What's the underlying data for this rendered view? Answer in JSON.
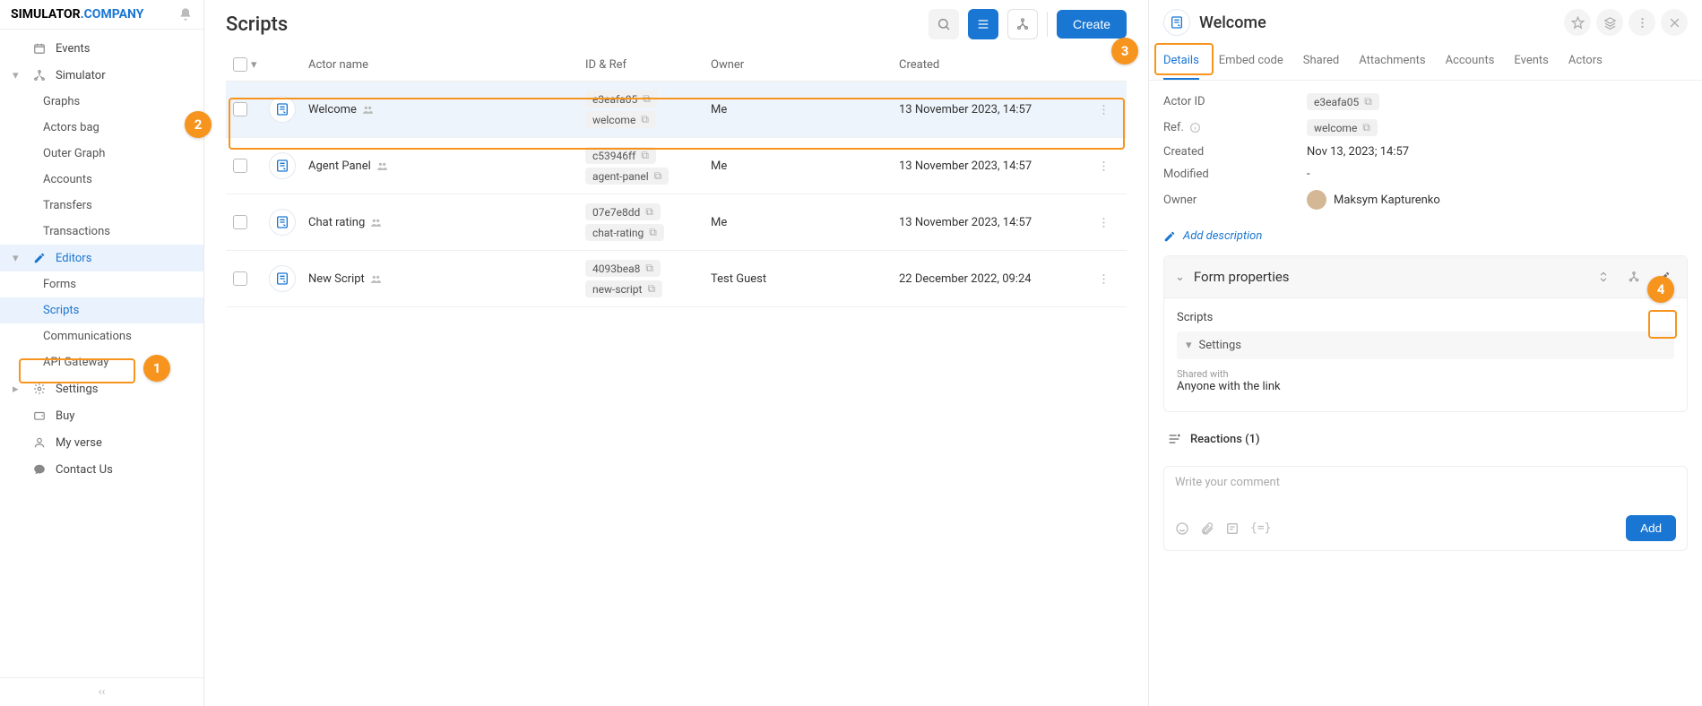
{
  "logo": {
    "part1": "SIMULATOR",
    "part2": ".COMPANY"
  },
  "sidebar": {
    "events": "Events",
    "simulator": "Simulator",
    "simulator_children": [
      "Graphs",
      "Actors bag",
      "Outer Graph",
      "Accounts",
      "Transfers",
      "Transactions"
    ],
    "editors": "Editors",
    "editors_children": [
      "Forms",
      "Scripts",
      "Communications",
      "API Gateway"
    ],
    "settings": "Settings",
    "buy": "Buy",
    "myverse": "My verse",
    "contact": "Contact Us"
  },
  "page": {
    "title": "Scripts",
    "create": "Create"
  },
  "table": {
    "headers": {
      "name": "Actor name",
      "id": "ID & Ref",
      "owner": "Owner",
      "created": "Created"
    },
    "rows": [
      {
        "name": "Welcome",
        "id": "e3eafa05",
        "ref": "welcome",
        "owner": "Me",
        "created": "13 November 2023, 14:57",
        "selected": true
      },
      {
        "name": "Agent Panel",
        "id": "c53946ff",
        "ref": "agent-panel",
        "owner": "Me",
        "created": "13 November 2023, 14:57",
        "selected": false
      },
      {
        "name": "Chat rating",
        "id": "07e7e8dd",
        "ref": "chat-rating",
        "owner": "Me",
        "created": "13 November 2023, 14:57",
        "selected": false
      },
      {
        "name": "New Script",
        "id": "4093bea8",
        "ref": "new-script",
        "owner": "Test Guest",
        "created": "22 December 2022, 09:24",
        "selected": false
      }
    ]
  },
  "rpanel": {
    "title": "Welcome",
    "tabs": [
      "Details",
      "Embed code",
      "Shared",
      "Attachments",
      "Accounts",
      "Events",
      "Actors"
    ],
    "details": {
      "actor_id_label": "Actor ID",
      "actor_id": "e3eafa05",
      "ref_label": "Ref.",
      "ref": "welcome",
      "created_label": "Created",
      "created": "Nov 13, 2023; 14:57",
      "modified_label": "Modified",
      "modified": "-",
      "owner_label": "Owner",
      "owner": "Maksym Kapturenko"
    },
    "add_desc": "Add description",
    "form_props": {
      "title": "Form properties",
      "scripts": "Scripts",
      "settings": "Settings",
      "shared_label": "Shared with",
      "shared_value": "Anyone with the link"
    },
    "reactions": "Reactions (1)",
    "comment_placeholder": "Write your comment",
    "add_btn": "Add"
  },
  "callouts": {
    "1": "1",
    "2": "2",
    "3": "3",
    "4": "4"
  }
}
